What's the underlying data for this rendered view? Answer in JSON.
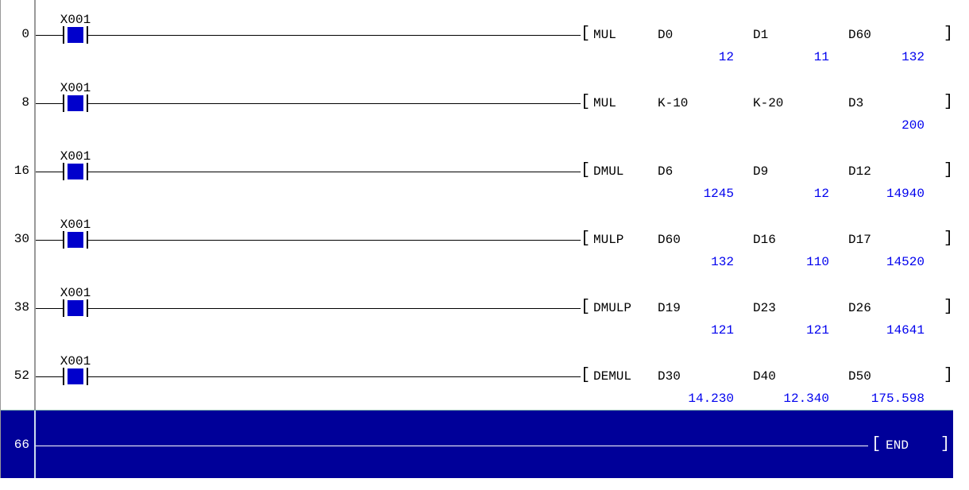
{
  "rungs": [
    {
      "step": "0",
      "contact": "X001",
      "op": "MUL",
      "args": [
        {
          "name": "D0",
          "val": "12"
        },
        {
          "name": "D1",
          "val": "11"
        },
        {
          "name": "D60",
          "val": "132"
        }
      ]
    },
    {
      "step": "8",
      "contact": "X001",
      "op": "MUL",
      "args": [
        {
          "name": "K-10",
          "val": ""
        },
        {
          "name": "K-20",
          "val": ""
        },
        {
          "name": "D3",
          "val": "200"
        }
      ]
    },
    {
      "step": "16",
      "contact": "X001",
      "op": "DMUL",
      "args": [
        {
          "name": "D6",
          "val": "1245"
        },
        {
          "name": "D9",
          "val": "12"
        },
        {
          "name": "D12",
          "val": "14940"
        }
      ]
    },
    {
      "step": "30",
      "contact": "X001",
      "op": "MULP",
      "args": [
        {
          "name": "D60",
          "val": "132"
        },
        {
          "name": "D16",
          "val": "110"
        },
        {
          "name": "D17",
          "val": "14520"
        }
      ]
    },
    {
      "step": "38",
      "contact": "X001",
      "op": "DMULP",
      "args": [
        {
          "name": "D19",
          "val": "121"
        },
        {
          "name": "D23",
          "val": "121"
        },
        {
          "name": "D26",
          "val": "14641"
        }
      ]
    },
    {
      "step": "52",
      "contact": "X001",
      "op": "DEMUL",
      "args": [
        {
          "name": "D30",
          "val": "14.230"
        },
        {
          "name": "D40",
          "val": "12.340"
        },
        {
          "name": "D50",
          "val": "175.598"
        }
      ]
    }
  ],
  "end": {
    "step": "66",
    "op": "END"
  }
}
